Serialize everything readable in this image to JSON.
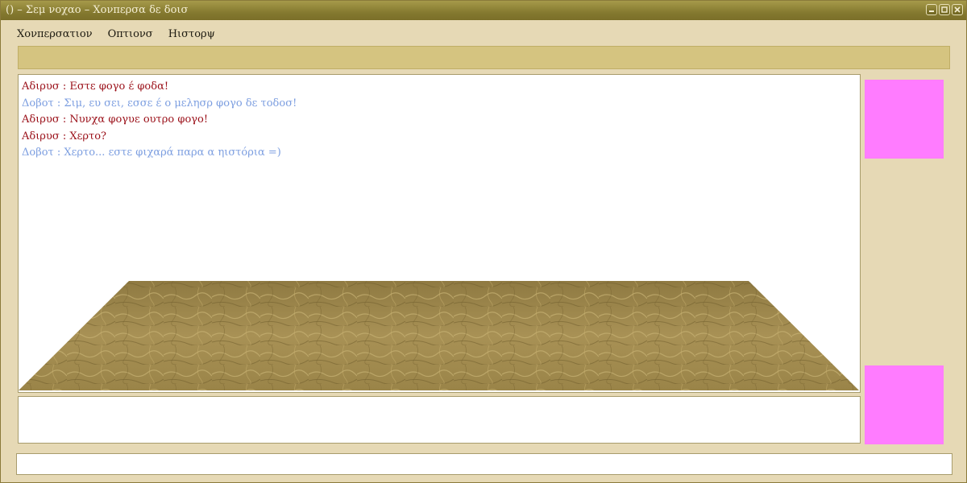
{
  "window": {
    "title": "() – Σεμ νοχαο – Χονπερσα δε δοισ"
  },
  "menu": {
    "items": [
      {
        "label": "Χονπερσατιον"
      },
      {
        "label": "Οπτιονσ"
      },
      {
        "label": "Ηιστορψ"
      }
    ]
  },
  "chat": {
    "messages": [
      {
        "text": "Αδιρυσ : Εστε φογο έ φοδα!",
        "speaker": "a"
      },
      {
        "text": "Δοβοτ : Σιμ, ευ σει, εσσε έ ο μελησρ φογο δε τοδοσ!",
        "speaker": "b"
      },
      {
        "text": "Αδιρυσ : Νυνχα φογυε ουτρο φογο!",
        "speaker": "a"
      },
      {
        "text": "Αδιρυσ : Χερτο?",
        "speaker": "a"
      },
      {
        "text": "Δοβοτ : Χερτο... εστε φιχαρά παρα α ηιστόρια =)",
        "speaker": "b"
      }
    ]
  },
  "colors": {
    "speaker_a": "#9a0f18",
    "speaker_b": "#7c9ee0",
    "avatar": "#ff7cff",
    "toolbar": "#d5c480",
    "title_bar": "#857a30"
  },
  "icons": {
    "minimize": "minimize-icon",
    "maximize": "maximize-icon",
    "close": "close-icon"
  }
}
